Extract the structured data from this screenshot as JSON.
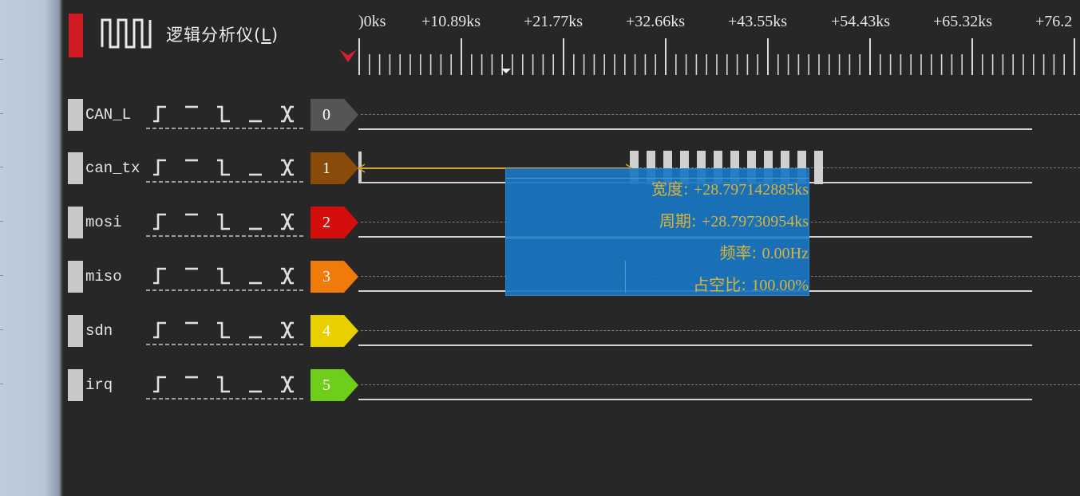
{
  "app": {
    "title": "逻辑分析仪(",
    "title_hotkey": "L",
    "title_close": ")",
    "logo_icon": "square-wave-icon",
    "accent_color": "#d01a24"
  },
  "timeline": {
    "labels": [
      ")0ks",
      "+10.89ks",
      "+21.77ks",
      "+32.66ks",
      "+43.55ks",
      "+54.43ks",
      "+65.32ks",
      "+76.2"
    ],
    "trigger_marker_icon": "trigger-chevron-icon"
  },
  "trigger_buttons": [
    "rising-edge-icon",
    "high-level-icon",
    "falling-edge-icon",
    "low-level-icon",
    "any-edge-icon"
  ],
  "channels": [
    {
      "name": "CAN_L",
      "index": "0",
      "color": "#555555"
    },
    {
      "name": "can_tx",
      "index": "1",
      "color": "#8a4a0a"
    },
    {
      "name": "mosi",
      "index": "2",
      "color": "#d40d0d"
    },
    {
      "name": "miso",
      "index": "3",
      "color": "#f07a0a"
    },
    {
      "name": "sdn",
      "index": "4",
      "color": "#e8cf00"
    },
    {
      "name": "irq",
      "index": "5",
      "color": "#6fce1a"
    }
  ],
  "measurement": {
    "width_label": "宽度: ",
    "width_value": "+28.797142885ks",
    "period_label": "周期: ",
    "period_value": "+28.79730954ks",
    "freq_label": "频率: ",
    "freq_value": "0.00Hz",
    "duty_label": "占空比: ",
    "duty_value": "100.00%",
    "cursor_color": "#d8a238",
    "box_color": "#1876c2"
  }
}
